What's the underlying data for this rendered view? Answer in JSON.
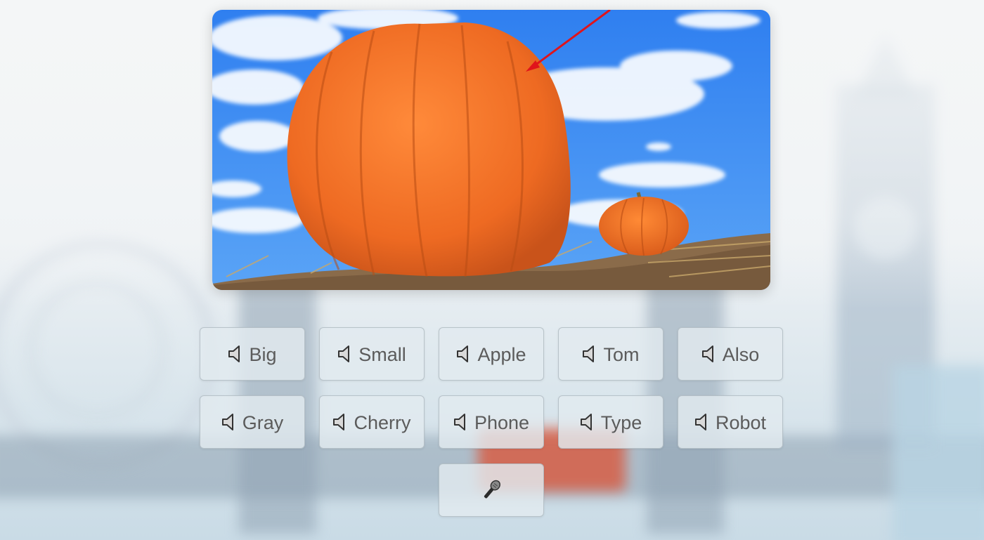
{
  "words": [
    {
      "label": "Big",
      "icon": "speaker-icon"
    },
    {
      "label": "Small",
      "icon": "speaker-icon"
    },
    {
      "label": "Apple",
      "icon": "speaker-icon"
    },
    {
      "label": "Tom",
      "icon": "speaker-icon"
    },
    {
      "label": "Also",
      "icon": "speaker-icon"
    },
    {
      "label": "Gray",
      "icon": "speaker-icon"
    },
    {
      "label": "Cherry",
      "icon": "speaker-icon"
    },
    {
      "label": "Phone",
      "icon": "speaker-icon"
    },
    {
      "label": "Type",
      "icon": "speaker-icon"
    },
    {
      "label": "Robot",
      "icon": "speaker-icon"
    }
  ],
  "mic_button": {
    "icon": "microphone-icon"
  },
  "picture": {
    "subject": "pumpkin-photo",
    "pointer_color": "#e0141b"
  },
  "colors": {
    "button_bg": "#e2eaef",
    "label_text": "#5b5b5b",
    "pumpkin": "#f2722a",
    "sky": "#3f8ff0"
  }
}
